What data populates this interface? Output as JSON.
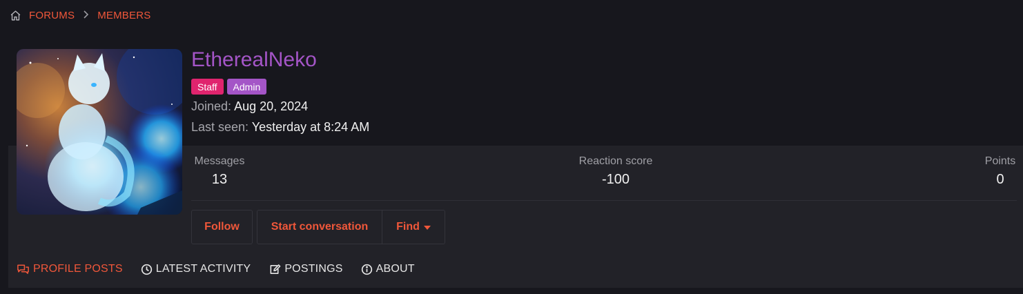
{
  "breadcrumb": {
    "items": [
      {
        "label": "FORUMS"
      },
      {
        "label": "MEMBERS"
      }
    ]
  },
  "profile": {
    "username": "EtherealNeko",
    "badges": [
      {
        "label": "Staff",
        "color": "#e0246e"
      },
      {
        "label": "Admin",
        "color": "#a455c7"
      }
    ],
    "joined_label": "Joined:",
    "joined_value": "Aug 20, 2024",
    "last_seen_label": "Last seen:",
    "last_seen_value": "Yesterday at 8:24 AM"
  },
  "stats": {
    "messages": {
      "label": "Messages",
      "value": "13"
    },
    "reaction": {
      "label": "Reaction score",
      "value": "-100"
    },
    "points": {
      "label": "Points",
      "value": "0"
    }
  },
  "actions": {
    "follow": "Follow",
    "start_conversation": "Start conversation",
    "find": "Find"
  },
  "tabs": [
    {
      "label": "PROFILE POSTS",
      "icon": "comments-icon",
      "active": true
    },
    {
      "label": "LATEST ACTIVITY",
      "icon": "clock-icon",
      "active": false
    },
    {
      "label": "POSTINGS",
      "icon": "edit-icon",
      "active": false
    },
    {
      "label": "ABOUT",
      "icon": "info-icon",
      "active": false
    }
  ],
  "colors": {
    "accent": "#f0573a",
    "username": "#a455c7",
    "background": "#17171d",
    "card": "#222228"
  }
}
